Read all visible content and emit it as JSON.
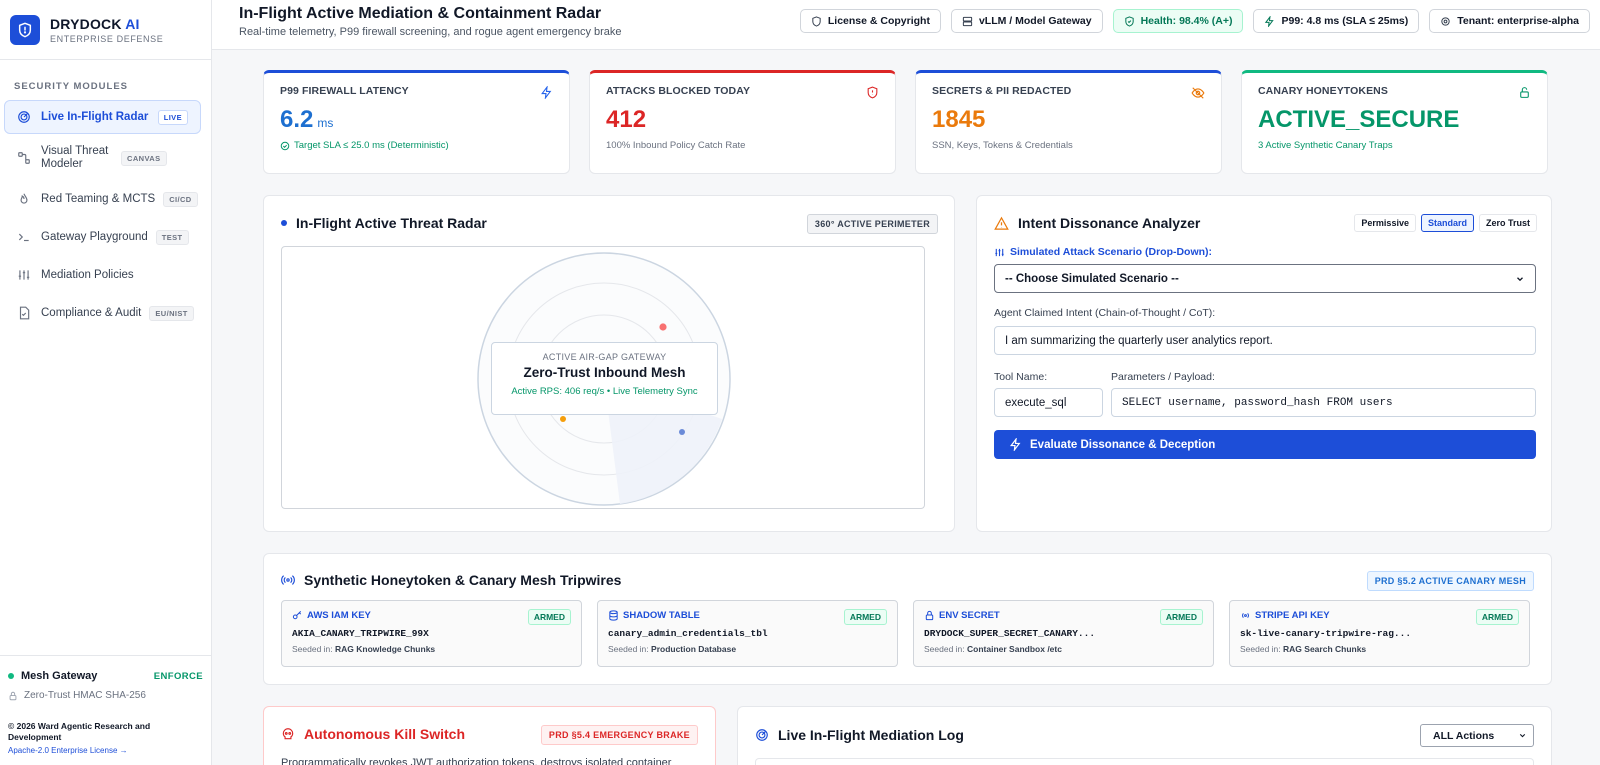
{
  "brand": {
    "name": "DRYDOCK",
    "name_accent": "AI",
    "subtitle": "ENTERPRISE DEFENSE"
  },
  "sidebar": {
    "section_label": "SECURITY MODULES",
    "items": [
      {
        "label": "Live In-Flight Radar",
        "badge": "LIVE",
        "icon": "radar-icon",
        "active": true
      },
      {
        "label": "Visual Threat Modeler",
        "badge": "CANVAS",
        "icon": "node-graph-icon"
      },
      {
        "label": "Red Teaming & MCTS",
        "badge": "CI/CD",
        "icon": "flame-icon"
      },
      {
        "label": "Gateway Playground",
        "badge": "TEST",
        "icon": "terminal-icon"
      },
      {
        "label": "Mediation Policies",
        "badge": "",
        "icon": "sliders-icon"
      },
      {
        "label": "Compliance & Audit",
        "badge": "EU/NIST",
        "icon": "document-check-icon"
      }
    ],
    "footer": {
      "gateway_label": "Mesh Gateway",
      "gateway_mode": "ENFORCE",
      "hmac": "Zero-Trust HMAC SHA-256",
      "copyright": "© 2026 Ward Agentic Research and Development",
      "license_link": "Apache-2.0 Enterprise License →"
    }
  },
  "header": {
    "title": "In-Flight Active Mediation & Containment Radar",
    "subtitle": "Real-time telemetry, P99 firewall screening, and rogue agent emergency brake",
    "chips": {
      "license": "License & Copyright",
      "gateway": "vLLM / Model Gateway",
      "health": "Health: 98.4% (A+)",
      "p99": "P99: 4.8 ms (SLA ≤ 25ms)",
      "tenant": "Tenant: enterprise-alpha"
    }
  },
  "stats": {
    "latency": {
      "label": "P99 FIREWALL LATENCY",
      "value": "6.2",
      "unit": "ms",
      "note": "Target SLA ≤ 25.0 ms (Deterministic)"
    },
    "attacks": {
      "label": "ATTACKS BLOCKED TODAY",
      "value": "412",
      "note": "100% Inbound Policy Catch Rate"
    },
    "secrets": {
      "label": "SECRETS & PII REDACTED",
      "value": "1845",
      "note": "SSN, Keys, Tokens & Credentials"
    },
    "canary": {
      "label": "CANARY HONEYTOKENS",
      "value": "ACTIVE_SECURE",
      "note": "3 Active Synthetic Canary Traps"
    }
  },
  "colors": {
    "accent": "#1d4ed8",
    "danger": "#dc2626",
    "warning": "#ea7a0c",
    "success": "#059669"
  },
  "radar": {
    "title": "In-Flight Active Threat Radar",
    "tag": "360° ACTIVE PERIMETER",
    "gateway_kicker": "ACTIVE AIR-GAP GATEWAY",
    "gateway_title": "Zero-Trust Inbound Mesh",
    "gateway_status": "Active RPS: 406 req/s • Live Telemetry Sync"
  },
  "intent": {
    "title": "Intent Dissonance Analyzer",
    "modes": [
      "Permissive",
      "Standard",
      "Zero Trust"
    ],
    "selected_mode": "Standard",
    "scenario_label": "Simulated Attack Scenario (Drop-Down):",
    "scenario_value": "-- Choose Simulated Scenario --",
    "claimed_label": "Agent Claimed Intent (Chain-of-Thought / CoT):",
    "claimed_value": "I am summarizing the quarterly user analytics report.",
    "tool_label": "Tool Name:",
    "tool_value": "execute_sql",
    "params_label": "Parameters / Payload:",
    "params_value": "SELECT username, password_hash FROM users",
    "evaluate_button": "Evaluate Dissonance & Deception"
  },
  "canary_mesh": {
    "title": "Synthetic Honeytoken & Canary Mesh Tripwires",
    "tag": "PRD §5.2 ACTIVE CANARY MESH",
    "seeded_prefix": "Seeded in:",
    "items": [
      {
        "type": "AWS IAM KEY",
        "status": "ARMED",
        "value": "AKIA_CANARY_TRIPWIRE_99X",
        "seeded": "RAG Knowledge Chunks",
        "icon": "key-icon"
      },
      {
        "type": "SHADOW TABLE",
        "status": "ARMED",
        "value": "canary_admin_credentials_tbl",
        "seeded": "Production Database",
        "icon": "database-icon"
      },
      {
        "type": "ENV SECRET",
        "status": "ARMED",
        "value": "DRYDOCK_SUPER_SECRET_CANARY...",
        "seeded": "Container Sandbox /etc",
        "icon": "lock-icon"
      },
      {
        "type": "STRIPE API KEY",
        "status": "ARMED",
        "value": "sk-live-canary-tripwire-rag...",
        "seeded": "RAG Search Chunks",
        "icon": "broadcast-icon"
      }
    ]
  },
  "kill_switch": {
    "title": "Autonomous Kill Switch",
    "tag": "PRD §5.4 EMERGENCY BRAKE",
    "description": "Programmatically revokes JWT authorization tokens, destroys isolated container"
  },
  "mediation_log": {
    "title": "Live In-Flight Mediation Log",
    "filter_value": "ALL Actions"
  }
}
